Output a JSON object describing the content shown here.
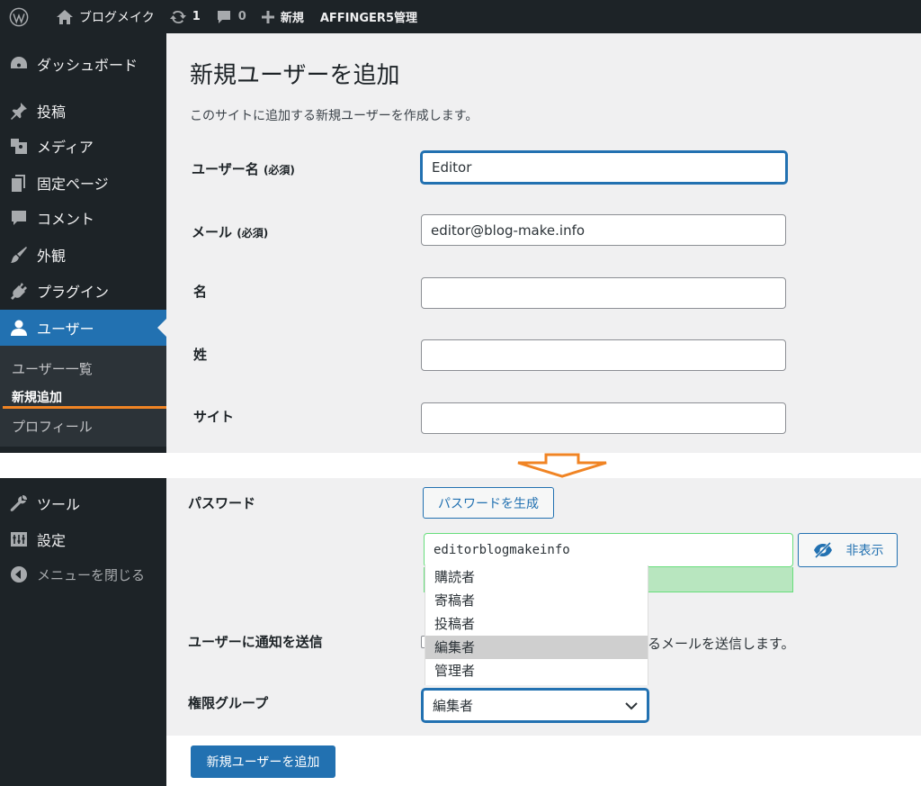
{
  "admin_bar": {
    "site_name": "ブログメイク",
    "updates_count": "1",
    "comments_count": "0",
    "new_label": "新規",
    "affinger_label": "AFFINGER5管理"
  },
  "sidebar": {
    "items": [
      {
        "label": "ダッシュボード",
        "icon": "dashboard-icon"
      },
      {
        "label": "投稿",
        "icon": "pin-icon"
      },
      {
        "label": "メディア",
        "icon": "media-icon"
      },
      {
        "label": "固定ページ",
        "icon": "page-icon"
      },
      {
        "label": "コメント",
        "icon": "comment-icon"
      },
      {
        "label": "外観",
        "icon": "brush-icon"
      },
      {
        "label": "プラグイン",
        "icon": "plugin-icon"
      },
      {
        "label": "ユーザー",
        "icon": "user-icon"
      }
    ],
    "submenu": [
      "ユーザー一覧",
      "新規追加",
      "プロフィール"
    ],
    "lower_items": [
      {
        "label": "ツール",
        "icon": "wrench-icon"
      },
      {
        "label": "設定",
        "icon": "settings-icon"
      },
      {
        "label": "メニューを閉じる",
        "icon": "collapse-icon"
      }
    ]
  },
  "page": {
    "title": "新規ユーザーを追加",
    "description": "このサイトに追加する新規ユーザーを作成します。"
  },
  "form": {
    "username_label": "ユーザー名",
    "username_required": "(必須)",
    "username_value": "Editor",
    "email_label": "メール",
    "email_required": "(必須)",
    "email_value": "editor@blog-make.info",
    "first_name_label": "名",
    "last_name_label": "姓",
    "website_label": "サイト",
    "password_label": "パスワード",
    "generate_password_button": "パスワードを生成",
    "password_value": "editorblogmakeinfo",
    "hide_button": "非表示",
    "notify_label": "ユーザーに通知を送信",
    "notify_text_tail": "するメールを送信します。",
    "role_label": "権限グループ",
    "role_selected": "編集者",
    "role_options": [
      "購読者",
      "寄稿者",
      "投稿者",
      "編集者",
      "管理者"
    ],
    "submit_button": "新規ユーザーを追加"
  },
  "colors": {
    "admin_dark": "#1d2327",
    "accent": "#2271b1",
    "background": "#f0f0f1",
    "annotation_orange": "#f08424",
    "strength_green": "#b8e6bf"
  }
}
